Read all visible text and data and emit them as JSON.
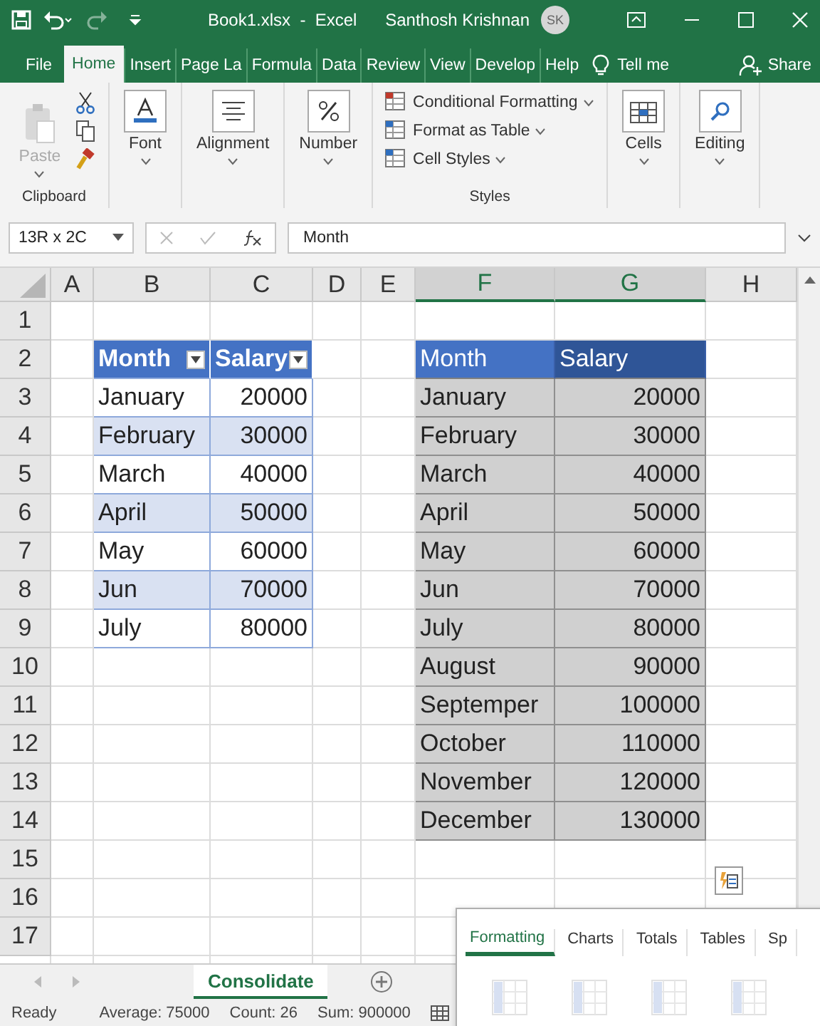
{
  "title_bar": {
    "file_title": "Book1.xlsx  -  Excel",
    "user_name": "Santhosh Krishnan",
    "avatar_initials": "SK"
  },
  "ribbon_tabs": [
    {
      "label": "File",
      "selected": false
    },
    {
      "label": "Home",
      "selected": true
    },
    {
      "label": "Insert",
      "selected": false
    },
    {
      "label": "Page La",
      "selected": false
    },
    {
      "label": "Formula",
      "selected": false
    },
    {
      "label": "Data",
      "selected": false
    },
    {
      "label": "Review",
      "selected": false
    },
    {
      "label": "View",
      "selected": false
    },
    {
      "label": "Develop",
      "selected": false
    },
    {
      "label": "Help",
      "selected": false
    }
  ],
  "tell_me": "Tell me",
  "share": "Share",
  "ribbon_groups": [
    {
      "kind": "clipboard",
      "title": "Clipboard",
      "paste": {
        "label": "Paste",
        "disabled": true
      }
    },
    {
      "kind": "font",
      "label": "Font"
    },
    {
      "kind": "alignment",
      "label": "Alignment"
    },
    {
      "kind": "number",
      "label": "Number"
    },
    {
      "kind": "styles",
      "title": "Styles",
      "items": [
        "Conditional Formatting",
        "Format as Table",
        "Cell Styles"
      ]
    },
    {
      "kind": "cells",
      "label": "Cells"
    },
    {
      "kind": "editing",
      "label": "Editing"
    }
  ],
  "formula_bar": {
    "name_box": "13R x 2C",
    "content": "Month"
  },
  "grid": {
    "columns": [
      {
        "label": "A",
        "selected": false
      },
      {
        "label": "B",
        "selected": false
      },
      {
        "label": "C",
        "selected": false
      },
      {
        "label": "D",
        "selected": false
      },
      {
        "label": "E",
        "selected": false
      },
      {
        "label": "F",
        "selected": true
      },
      {
        "label": "G",
        "selected": true
      },
      {
        "label": "H",
        "selected": false
      }
    ],
    "rows": [
      "1",
      "2",
      "3",
      "4",
      "5",
      "6",
      "7",
      "8",
      "9",
      "10",
      "11",
      "12",
      "13",
      "14",
      "15",
      "16",
      "17"
    ]
  },
  "left_table": {
    "headers": [
      "Month",
      "Salary"
    ],
    "rows": [
      [
        "January",
        "20000"
      ],
      [
        "February",
        "30000"
      ],
      [
        "March",
        "40000"
      ],
      [
        "April",
        "50000"
      ],
      [
        "May",
        "60000"
      ],
      [
        "Jun",
        "70000"
      ],
      [
        "July",
        "80000"
      ]
    ]
  },
  "right_table": {
    "headers": [
      "Month",
      "Salary"
    ],
    "rows": [
      [
        "January",
        "20000"
      ],
      [
        "February",
        "30000"
      ],
      [
        "March",
        "40000"
      ],
      [
        "April",
        "50000"
      ],
      [
        "May",
        "60000"
      ],
      [
        "Jun",
        "70000"
      ],
      [
        "July",
        "80000"
      ],
      [
        "August",
        "90000"
      ],
      [
        "Septemper",
        "100000"
      ],
      [
        "October",
        "110000"
      ],
      [
        "November",
        "120000"
      ],
      [
        "December",
        "130000"
      ]
    ]
  },
  "sheet_tabs": [
    {
      "label": "Consolidate",
      "selected": true
    }
  ],
  "status_bar": {
    "mode": "Ready",
    "stats": [
      "Average: 75000",
      "Count: 26",
      "Sum: 900000"
    ]
  },
  "quick_analysis": {
    "tabs": [
      {
        "label": "Formatting",
        "selected": true
      },
      {
        "label": "Charts",
        "selected": false
      },
      {
        "label": "Totals",
        "selected": false
      },
      {
        "label": "Tables",
        "selected": false
      },
      {
        "label": "Sp",
        "selected": false
      }
    ]
  }
}
